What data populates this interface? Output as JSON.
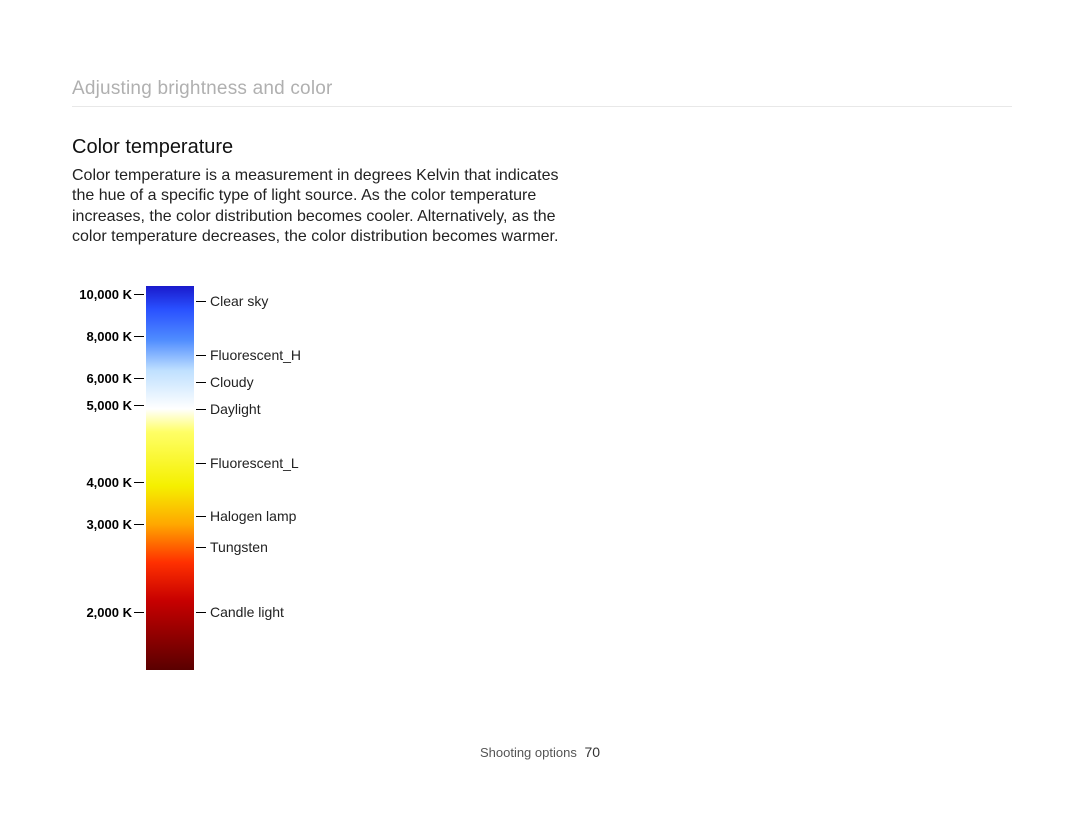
{
  "header": {
    "breadcrumb": "Adjusting brightness and color"
  },
  "section": {
    "title": "Color temperature",
    "body": "Color temperature is a measurement in degrees Kelvin that indicates the hue of a specific type of light source. As the color temperature increases, the color distribution becomes cooler. Alternatively, as the color temperature decreases, the color distribution becomes warmer."
  },
  "diagram": {
    "kelvin_ticks": [
      {
        "label": "10,000 K",
        "pos": 0.02
      },
      {
        "label": "8,000 K",
        "pos": 0.13
      },
      {
        "label": "6,000 K",
        "pos": 0.24
      },
      {
        "label": "5,000 K",
        "pos": 0.31
      },
      {
        "label": "4,000 K",
        "pos": 0.51
      },
      {
        "label": "3,000 K",
        "pos": 0.62
      },
      {
        "label": "2,000 K",
        "pos": 0.85
      }
    ],
    "light_sources": [
      {
        "label": "Clear sky",
        "pos": 0.04
      },
      {
        "label": "Fluorescent_H",
        "pos": 0.18
      },
      {
        "label": "Cloudy",
        "pos": 0.25
      },
      {
        "label": "Daylight",
        "pos": 0.32
      },
      {
        "label": "Fluorescent_L",
        "pos": 0.46
      },
      {
        "label": "Halogen lamp",
        "pos": 0.6
      },
      {
        "label": "Tungsten",
        "pos": 0.68
      },
      {
        "label": "Candle light",
        "pos": 0.85
      }
    ]
  },
  "footer": {
    "section": "Shooting options",
    "page": "70"
  }
}
